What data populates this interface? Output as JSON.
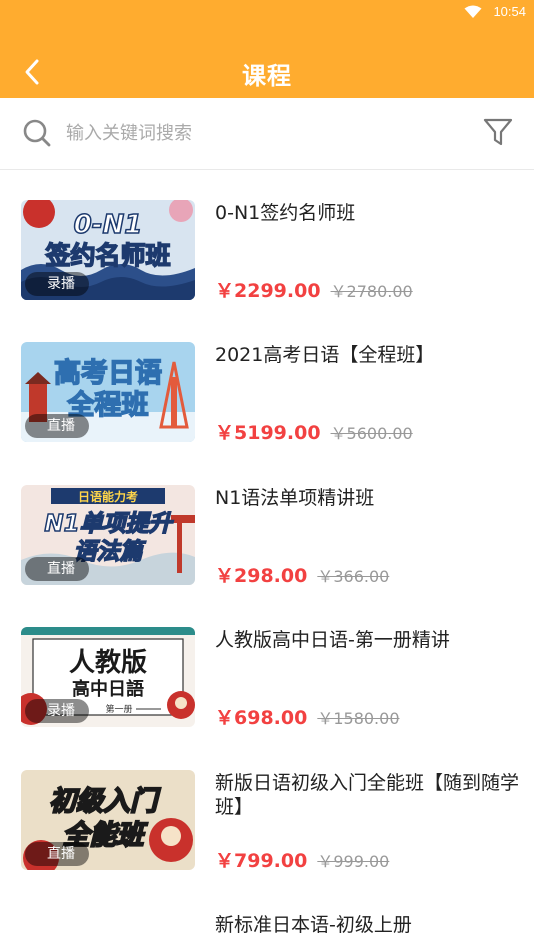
{
  "status_bar": {
    "time": "10:54"
  },
  "header": {
    "title": "课程"
  },
  "search": {
    "placeholder": "输入关键词搜索"
  },
  "courses": [
    {
      "title": "0-N1签约名师班",
      "thumb_text_1": "0-N1",
      "thumb_text_2": "签约名师班",
      "badge": "录播",
      "price": "￥2299.00",
      "original_price": "￥2780.00"
    },
    {
      "title": "2021高考日语【全程班】",
      "thumb_text_1": "高考日语",
      "thumb_text_2": "全程班",
      "badge": "直播",
      "price": "￥5199.00",
      "original_price": "￥5600.00"
    },
    {
      "title": "N1语法单项精讲班",
      "thumb_text_0": "日语能力考",
      "thumb_text_1": "N1单项提升",
      "thumb_text_2": "语法篇",
      "badge": "直播",
      "price": "￥298.00",
      "original_price": "￥366.00"
    },
    {
      "title": "人教版高中日语-第一册精讲",
      "thumb_text_1": "人教版",
      "thumb_text_2": "高中日語",
      "thumb_text_3": "第一册",
      "badge": "录播",
      "price": "￥698.00",
      "original_price": "￥1580.00"
    },
    {
      "title": "新版日语初级入门全能班【随到随学班】",
      "thumb_text_1": "初级入门",
      "thumb_text_2": "全能班",
      "badge": "直播",
      "price": "￥799.00",
      "original_price": "￥999.00"
    },
    {
      "title": "新标准日本语-初级上册"
    }
  ],
  "colors": {
    "header": "#FFAC2F",
    "price": "#F24141",
    "original_price": "#999999"
  }
}
